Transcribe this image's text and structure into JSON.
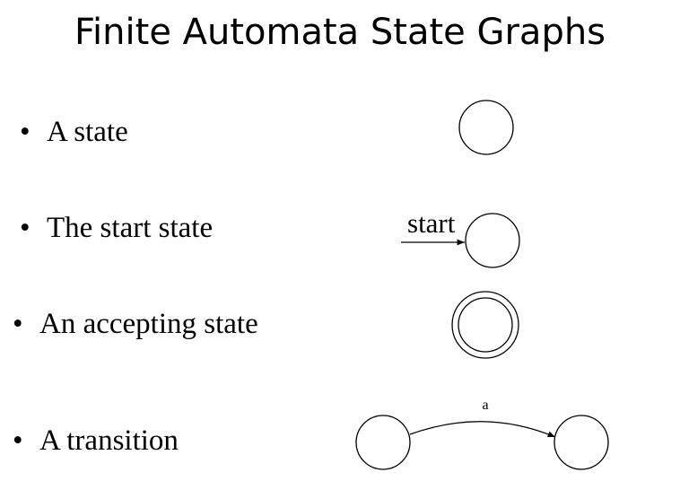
{
  "title": "Finite Automata State Graphs",
  "bullet_symbol": "•",
  "items": [
    {
      "label": "A state"
    },
    {
      "label": "The start state"
    },
    {
      "label": "An accepting state"
    },
    {
      "label": "A transition"
    }
  ],
  "diagram": {
    "start_label": "start",
    "transition_label": "a"
  }
}
